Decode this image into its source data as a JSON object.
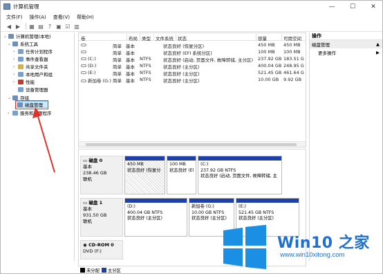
{
  "window": {
    "title": "计算机管理",
    "controls": {
      "minimize": "—",
      "maximize": "☐",
      "close": "✕"
    }
  },
  "menu": [
    "文件(F)",
    "操作(A)",
    "查看(V)",
    "帮助(H)"
  ],
  "tree": {
    "root": "计算机管理(本地)",
    "items": [
      {
        "label": "系统工具",
        "color": "#6d8fb8"
      },
      {
        "label": "任务计划程序",
        "color": "#7aa0c8"
      },
      {
        "label": "事件查看器",
        "color": "#7aa0c8"
      },
      {
        "label": "共享文件夹",
        "color": "#d4b04a"
      },
      {
        "label": "本地用户和组",
        "color": "#7aa0c8"
      },
      {
        "label": "性能",
        "color": "#c0392b"
      },
      {
        "label": "设备管理器",
        "color": "#7aa0c8"
      },
      {
        "label": "存储",
        "color": "#6d8fb8"
      },
      {
        "label": "磁盘管理",
        "color": "#6d8fb8"
      },
      {
        "label": "服务和应用程序",
        "color": "#7aa0c8"
      }
    ]
  },
  "list": {
    "headers": [
      "卷",
      "布局",
      "类型",
      "文件系统",
      "状态",
      "容量",
      "可用空间"
    ],
    "rows": [
      [
        "",
        "简单",
        "基本",
        "",
        "状态良好 (恢复分区)",
        "450 MB",
        "450 MB"
      ],
      [
        "",
        "简单",
        "基本",
        "",
        "状态良好 (EFI 系统分区)",
        "100 MB",
        "100 MB"
      ],
      [
        "(C:)",
        "简单",
        "基本",
        "NTFS",
        "状态良好 (启动, 页面文件, 故障转储, 主分区)",
        "237.92 GB",
        "183.51 G"
      ],
      [
        "(D:)",
        "简单",
        "基本",
        "NTFS",
        "状态良好 (主分区)",
        "400.04 GB",
        "248.95 G"
      ],
      [
        "(E:)",
        "简单",
        "基本",
        "NTFS",
        "状态良好 (主分区)",
        "521.45 GB",
        "461.64 G"
      ],
      [
        "新加卷 (G:)",
        "简单",
        "基本",
        "NTFS",
        "状态良好 (主分区)",
        "10.00 GB",
        "9.92 GB"
      ]
    ]
  },
  "actions": {
    "header": "操作",
    "section": "磁盘管理",
    "item": "更多操作"
  },
  "disks": [
    {
      "name": "磁盘 0",
      "type": "基本",
      "size": "238.46 GB",
      "status": "联机",
      "partitions": [
        {
          "title": "",
          "line1": "450 MB",
          "line2": "状态良好 (恢复分",
          "hatched": true
        },
        {
          "title": "",
          "line1": "100 MB",
          "line2": "状态良好 (El",
          "hatched": false
        },
        {
          "title": "(C:)",
          "line1": "237.92 GB NTFS",
          "line2": "状态良好 (启动, 页面文件, 故障转储, 主",
          "hatched": false
        }
      ]
    },
    {
      "name": "磁盘 1",
      "type": "基本",
      "size": "931.50 GB",
      "status": "联机",
      "partitions": [
        {
          "title": "(D:)",
          "line1": "400.04 GB NTFS",
          "line2": "状态良好 (主分区)",
          "hatched": false
        },
        {
          "title": "新加卷 (G:)",
          "line1": "10.00 GB NTFS",
          "line2": "状态良好 (主分区)",
          "hatched": false
        },
        {
          "title": "(E:)",
          "line1": "521.45 GB NTFS",
          "line2": "状态良好 (主分区)",
          "hatched": false
        }
      ]
    },
    {
      "name": "CD-ROM 0",
      "type": "DVD (F:)",
      "size": "",
      "status": "",
      "partitions": []
    }
  ],
  "legend": [
    {
      "label": "未分配",
      "color": "#000000"
    },
    {
      "label": "主分区",
      "color": "#1f3fa8"
    }
  ],
  "status_text": "",
  "watermark": {
    "title": "Win10 之家",
    "url": "www.win10xitong.com",
    "color": "#1d6fd0"
  }
}
